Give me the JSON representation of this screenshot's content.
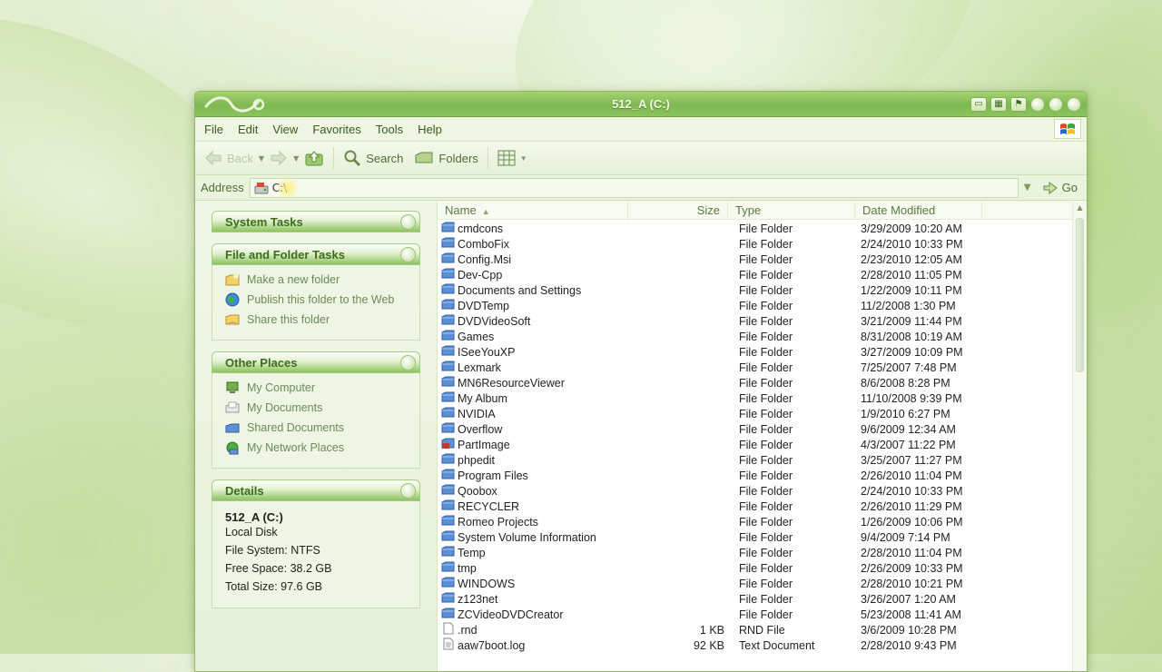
{
  "window": {
    "title": "512_A (C:)",
    "menu": [
      "File",
      "Edit",
      "View",
      "Favorites",
      "Tools",
      "Help"
    ],
    "toolbar": {
      "back": "Back",
      "search": "Search",
      "folders": "Folders"
    },
    "address": {
      "label": "Address",
      "value": "C:\\",
      "go": "Go"
    }
  },
  "sidebar": {
    "system_tasks": {
      "title": "System Tasks"
    },
    "file_folder_tasks": {
      "title": "File and Folder Tasks",
      "items": [
        "Make a new folder",
        "Publish this folder to the Web",
        "Share this folder"
      ]
    },
    "other_places": {
      "title": "Other Places",
      "items": [
        "My Computer",
        "My Documents",
        "Shared Documents",
        "My Network Places"
      ]
    },
    "details": {
      "title": "Details",
      "name": "512_A (C:)",
      "kind": "Local Disk",
      "file_system": "File System: NTFS",
      "free_space": "Free Space: 38.2 GB",
      "total_size": "Total Size: 97.6 GB"
    }
  },
  "columns": {
    "name": "Name",
    "size": "Size",
    "type": "Type",
    "date": "Date Modified"
  },
  "files": [
    {
      "name": "cmdcons",
      "size": "",
      "type": "File Folder",
      "date": "3/29/2009 10:20 AM",
      "icon": "folder"
    },
    {
      "name": "ComboFix",
      "size": "",
      "type": "File Folder",
      "date": "2/24/2010 10:33 PM",
      "icon": "folder"
    },
    {
      "name": "Config.Msi",
      "size": "",
      "type": "File Folder",
      "date": "2/23/2010 12:05 AM",
      "icon": "folder"
    },
    {
      "name": "Dev-Cpp",
      "size": "",
      "type": "File Folder",
      "date": "2/28/2010 11:05 PM",
      "icon": "folder"
    },
    {
      "name": "Documents and Settings",
      "size": "",
      "type": "File Folder",
      "date": "1/22/2009 10:11 PM",
      "icon": "folder"
    },
    {
      "name": "DVDTemp",
      "size": "",
      "type": "File Folder",
      "date": "11/2/2008 1:30 PM",
      "icon": "folder"
    },
    {
      "name": "DVDVideoSoft",
      "size": "",
      "type": "File Folder",
      "date": "3/21/2009 11:44 PM",
      "icon": "folder"
    },
    {
      "name": "Games",
      "size": "",
      "type": "File Folder",
      "date": "8/31/2008 10:19 AM",
      "icon": "folder"
    },
    {
      "name": "ISeeYouXP",
      "size": "",
      "type": "File Folder",
      "date": "3/27/2009 10:09 PM",
      "icon": "folder"
    },
    {
      "name": "Lexmark",
      "size": "",
      "type": "File Folder",
      "date": "7/25/2007 7:48 PM",
      "icon": "folder"
    },
    {
      "name": "MN6ResourceViewer",
      "size": "",
      "type": "File Folder",
      "date": "8/6/2008 8:28 PM",
      "icon": "folder"
    },
    {
      "name": "My Album",
      "size": "",
      "type": "File Folder",
      "date": "11/10/2008 9:39 PM",
      "icon": "folder"
    },
    {
      "name": "NVIDIA",
      "size": "",
      "type": "File Folder",
      "date": "1/9/2010 6:27 PM",
      "icon": "folder"
    },
    {
      "name": "Overflow",
      "size": "",
      "type": "File Folder",
      "date": "9/6/2009 12:34 AM",
      "icon": "folder"
    },
    {
      "name": "PartImage",
      "size": "",
      "type": "File Folder",
      "date": "4/3/2007 11:22 PM",
      "icon": "shared-folder"
    },
    {
      "name": "phpedit",
      "size": "",
      "type": "File Folder",
      "date": "3/25/2007 11:27 PM",
      "icon": "folder"
    },
    {
      "name": "Program Files",
      "size": "",
      "type": "File Folder",
      "date": "2/26/2010 11:04 PM",
      "icon": "folder"
    },
    {
      "name": "Qoobox",
      "size": "",
      "type": "File Folder",
      "date": "2/24/2010 10:33 PM",
      "icon": "folder"
    },
    {
      "name": "RECYCLER",
      "size": "",
      "type": "File Folder",
      "date": "2/26/2010 11:29 PM",
      "icon": "folder"
    },
    {
      "name": "Romeo Projects",
      "size": "",
      "type": "File Folder",
      "date": "1/26/2009 10:06 PM",
      "icon": "folder"
    },
    {
      "name": "System Volume Information",
      "size": "",
      "type": "File Folder",
      "date": "9/4/2009 7:14 PM",
      "icon": "folder"
    },
    {
      "name": "Temp",
      "size": "",
      "type": "File Folder",
      "date": "2/28/2010 11:04 PM",
      "icon": "folder"
    },
    {
      "name": "tmp",
      "size": "",
      "type": "File Folder",
      "date": "2/26/2009 10:33 PM",
      "icon": "folder"
    },
    {
      "name": "WINDOWS",
      "size": "",
      "type": "File Folder",
      "date": "2/28/2010 10:21 PM",
      "icon": "folder"
    },
    {
      "name": "z123net",
      "size": "",
      "type": "File Folder",
      "date": "3/26/2007 1:20 AM",
      "icon": "folder"
    },
    {
      "name": "ZCVideoDVDCreator",
      "size": "",
      "type": "File Folder",
      "date": "5/23/2008 11:41 AM",
      "icon": "folder"
    },
    {
      "name": ".rnd",
      "size": "1 KB",
      "type": "RND File",
      "date": "3/6/2009 10:28 PM",
      "icon": "file"
    },
    {
      "name": "aaw7boot.log",
      "size": "92 KB",
      "type": "Text Document",
      "date": "2/28/2010 9:43 PM",
      "icon": "text-file"
    }
  ],
  "colors": {
    "accent": "#8cc35c",
    "title_text": "#f4fbe8",
    "sidebar_text": "#3c6c1c"
  }
}
